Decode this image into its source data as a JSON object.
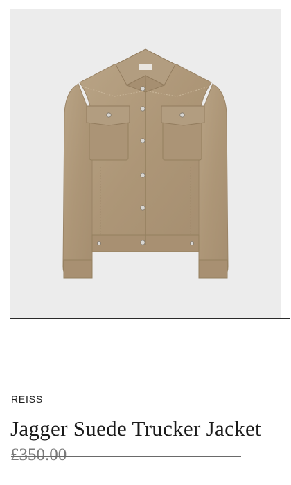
{
  "product": {
    "image_alt": "Jagger Suede Trucker Jacket",
    "brand": "REISS",
    "title": "Jagger Suede Trucker Jacket",
    "original_price": "£350.00"
  },
  "colors": {
    "image_background": "#ececec",
    "jacket": "#b09a7c",
    "text": "#1a1a1a",
    "muted": "#7a7a7a"
  },
  "icons": {
    "product_photo": "jacket-photo"
  }
}
